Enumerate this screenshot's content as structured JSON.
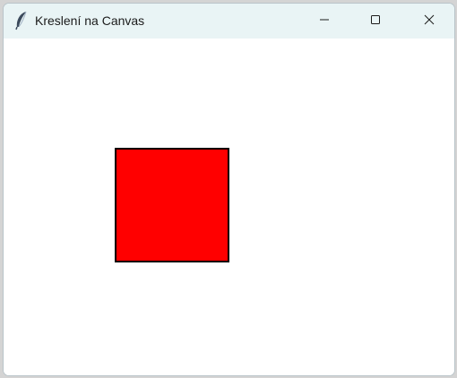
{
  "window": {
    "title": "Kreslení na Canvas",
    "app_icon": "feather-icon"
  },
  "controls": {
    "minimize_icon": "minimize-icon",
    "maximize_icon": "maximize-icon",
    "close_icon": "close-icon"
  },
  "canvas": {
    "background": "#ffffff",
    "shapes": [
      {
        "type": "rectangle",
        "fill": "#ff0000",
        "outline": "#000000"
      }
    ]
  }
}
